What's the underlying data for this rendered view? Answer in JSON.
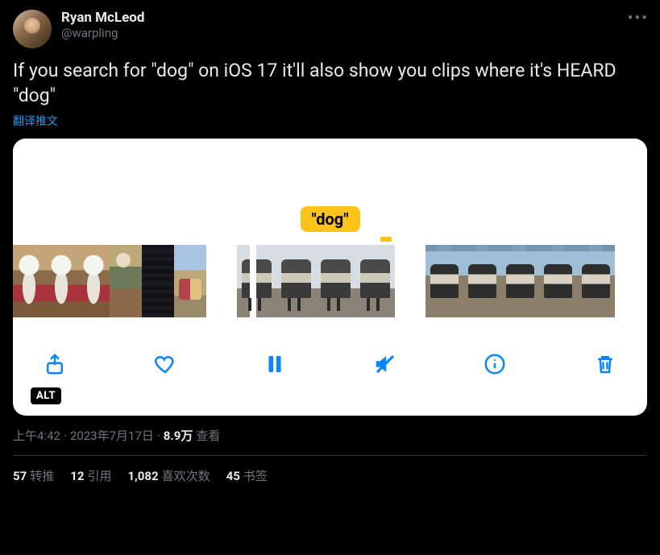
{
  "user": {
    "display_name": "Ryan McLeod",
    "handle": "@warpling"
  },
  "tweet": {
    "text": "If you search for \"dog\" on iOS 17 it'll also show you clips where it's HEARD \"dog\"",
    "translate_label": "翻译推文"
  },
  "media": {
    "chip": "\"dog\"",
    "alt_badge": "ALT"
  },
  "meta": {
    "time": "上午4:42",
    "date": "2023年7月17日",
    "sep": "·",
    "views_count": "8.9万",
    "views_label": "查看"
  },
  "stats": {
    "retweets_n": "57",
    "retweets_l": "转推",
    "quotes_n": "12",
    "quotes_l": "引用",
    "likes_n": "1,082",
    "likes_l": "喜欢次数",
    "bookmarks_n": "45",
    "bookmarks_l": "书签"
  }
}
